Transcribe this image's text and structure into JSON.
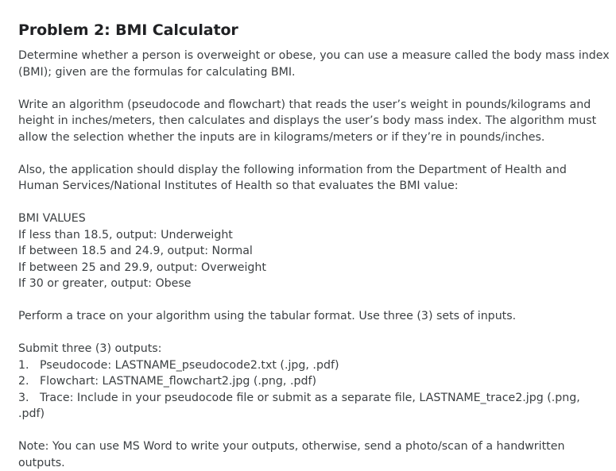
{
  "title": "Problem 2: BMI Calculator",
  "intro": [
    "Determine whether a person is overweight or obese, you can use a measure called the body mass index",
    "(BMI); given are the formulas for calculating BMI."
  ],
  "task": [
    "Write an algorithm (pseudocode and flowchart) that reads the user’s weight in pounds/kilograms and",
    "height in inches/meters, then calculates and displays the user’s body mass index.  The algorithm must",
    "allow the selection whether the inputs are in kilograms/meters or if they’re in pounds/inches."
  ],
  "also": [
    "Also, the application should display the following information from the Department of Health and",
    "Human Services/National Institutes of Health so that evaluates the BMI value:"
  ],
  "bmi_values": {
    "heading": "BMI VALUES",
    "rules": [
      "If less than 18.5, output: Underweight",
      "If between 18.5 and 24.9, output: Normal",
      "If between 25 and 29.9, output: Overweight",
      "If 30 or greater, output: Obese"
    ]
  },
  "trace": "Perform a trace on your algorithm using the tabular format. Use three (3) sets of inputs.",
  "submit": {
    "heading": "Submit three (3) outputs:",
    "items": [
      {
        "num": "1.",
        "text": "Pseudocode: LASTNAME_pseudocode2.txt (.jpg, .pdf)"
      },
      {
        "num": "2.",
        "text": "Flowchart: LASTNAME_flowchart2.jpg (.png, .pdf)"
      },
      {
        "num": "3.",
        "text": "Trace: Include in your pseudocode file or submit as a separate file, LASTNAME_trace2.jpg (.png,"
      }
    ],
    "item3_cont": ".pdf)"
  },
  "note": [
    "Note: You can use MS Word to write your outputs, otherwise, send a photo/scan of a handwritten",
    "outputs."
  ]
}
